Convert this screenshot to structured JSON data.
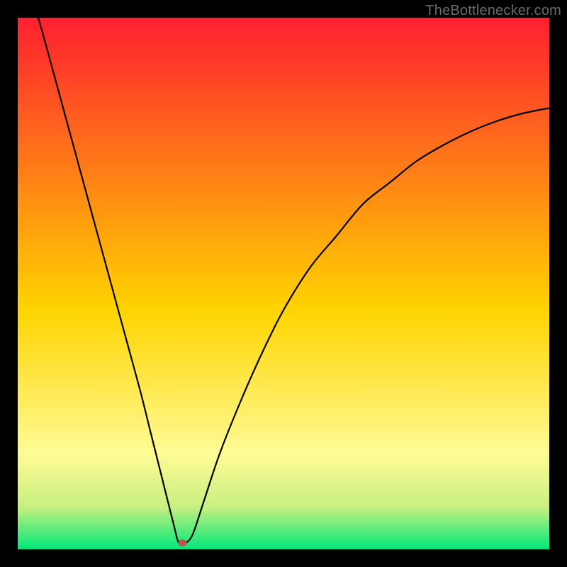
{
  "watermark": "TheBottlenecker.com",
  "colors": {
    "top": "#ff1f30",
    "mid": "#ffd400",
    "bottom_band_top": "#fffb95",
    "bottom_band_mid": "#c8f080",
    "bottom_band_end": "#00e87a",
    "frame": "#000000",
    "curve": "#000000",
    "marker": "#c0544e"
  },
  "chart_data": {
    "type": "line",
    "title": "",
    "xlabel": "",
    "ylabel": "",
    "xlim": [
      0,
      100
    ],
    "ylim": [
      0,
      100
    ],
    "marker": {
      "x": 31,
      "y": 1.2
    },
    "curve_points": [
      {
        "x": 3,
        "y": 103
      },
      {
        "x": 5,
        "y": 96
      },
      {
        "x": 8,
        "y": 85
      },
      {
        "x": 11,
        "y": 74
      },
      {
        "x": 14,
        "y": 63
      },
      {
        "x": 17,
        "y": 52
      },
      {
        "x": 20,
        "y": 41
      },
      {
        "x": 23,
        "y": 30
      },
      {
        "x": 25,
        "y": 22
      },
      {
        "x": 27,
        "y": 14
      },
      {
        "x": 28.5,
        "y": 8
      },
      {
        "x": 29.5,
        "y": 4
      },
      {
        "x": 30.2,
        "y": 1.4
      },
      {
        "x": 31,
        "y": 1.1
      },
      {
        "x": 31.8,
        "y": 1.3
      },
      {
        "x": 33,
        "y": 3
      },
      {
        "x": 35,
        "y": 9
      },
      {
        "x": 38,
        "y": 18
      },
      {
        "x": 42,
        "y": 28
      },
      {
        "x": 46,
        "y": 37
      },
      {
        "x": 50,
        "y": 45
      },
      {
        "x": 55,
        "y": 53
      },
      {
        "x": 60,
        "y": 59
      },
      {
        "x": 65,
        "y": 65
      },
      {
        "x": 70,
        "y": 69
      },
      {
        "x": 75,
        "y": 73
      },
      {
        "x": 80,
        "y": 76
      },
      {
        "x": 85,
        "y": 78.5
      },
      {
        "x": 90,
        "y": 80.5
      },
      {
        "x": 95,
        "y": 82
      },
      {
        "x": 100,
        "y": 83
      }
    ]
  }
}
